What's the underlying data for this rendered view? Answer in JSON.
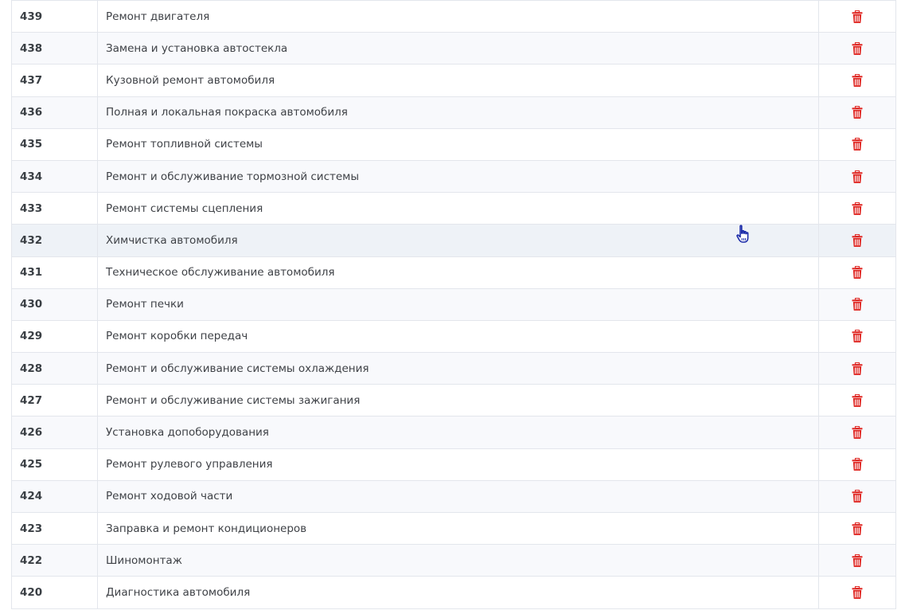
{
  "colors": {
    "delete_icon": "#e02b27",
    "row_alt": "#f8f9fc",
    "row_hover": "#eef2f7",
    "border": "#e3e6ec"
  },
  "rows": [
    {
      "id": "439",
      "name": "Ремонт двигателя"
    },
    {
      "id": "438",
      "name": "Замена и установка автостекла"
    },
    {
      "id": "437",
      "name": "Кузовной ремонт автомобиля"
    },
    {
      "id": "436",
      "name": "Полная и локальная покраска автомобиля"
    },
    {
      "id": "435",
      "name": "Ремонт топливной системы"
    },
    {
      "id": "434",
      "name": "Ремонт и обслуживание тормозной системы"
    },
    {
      "id": "433",
      "name": "Ремонт системы сцепления"
    },
    {
      "id": "432",
      "name": "Химчистка автомобиля"
    },
    {
      "id": "431",
      "name": "Техническое обслуживание автомобиля"
    },
    {
      "id": "430",
      "name": "Ремонт печки"
    },
    {
      "id": "429",
      "name": "Ремонт коробки передач"
    },
    {
      "id": "428",
      "name": "Ремонт и обслуживание системы охлаждения"
    },
    {
      "id": "427",
      "name": "Ремонт и обслуживание системы зажигания"
    },
    {
      "id": "426",
      "name": "Установка допоборудования"
    },
    {
      "id": "425",
      "name": "Ремонт рулевого управления"
    },
    {
      "id": "424",
      "name": "Ремонт ходовой части"
    },
    {
      "id": "423",
      "name": "Заправка и ремонт кондиционеров"
    },
    {
      "id": "422",
      "name": "Шиномонтаж"
    },
    {
      "id": "420",
      "name": "Диагностика автомобиля"
    }
  ],
  "hovered_row_id": "432",
  "icons": {
    "delete": "trash-icon",
    "cursor": "hand-pointer-icon"
  }
}
